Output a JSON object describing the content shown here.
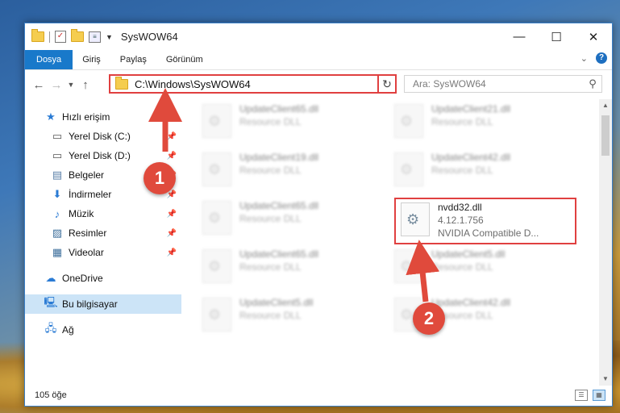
{
  "window": {
    "title": "SysWOW64",
    "controls": {
      "minimize": "—",
      "maximize": "☐",
      "close": "✕"
    }
  },
  "ribbon": {
    "tabs": [
      "Dosya",
      "Giriş",
      "Paylaş",
      "Görünüm"
    ]
  },
  "nav": {
    "address": "C:\\Windows\\SysWOW64",
    "search_placeholder": "Ara: SysWOW64"
  },
  "sidebar": {
    "items": [
      {
        "label": "Hızlı erişim",
        "icon": "star-icon",
        "pinned": false
      },
      {
        "label": "Yerel Disk (C:)",
        "icon": "drive-icon",
        "pinned": true
      },
      {
        "label": "Yerel Disk (D:)",
        "icon": "drive-icon",
        "pinned": true
      },
      {
        "label": "Belgeler",
        "icon": "documents-icon",
        "pinned": true
      },
      {
        "label": "İndirmeler",
        "icon": "download-icon",
        "pinned": true
      },
      {
        "label": "Müzik",
        "icon": "music-icon",
        "pinned": true
      },
      {
        "label": "Resimler",
        "icon": "pictures-icon",
        "pinned": true
      },
      {
        "label": "Videolar",
        "icon": "videos-icon",
        "pinned": true
      },
      {
        "label": "OneDrive",
        "icon": "cloud-icon",
        "pinned": false
      },
      {
        "label": "Bu bilgisayar",
        "icon": "computer-icon",
        "pinned": false
      },
      {
        "label": "Ağ",
        "icon": "network-icon",
        "pinned": false
      }
    ]
  },
  "files": {
    "left_column": [
      {
        "name": "UpdateClient65.dll",
        "type": "Resource DLL"
      },
      {
        "name": "UpdateClient19.dll",
        "type": "Resource DLL"
      },
      {
        "name": "UpdateClient65.dll",
        "type": "Resource DLL"
      },
      {
        "name": "UpdateClient65.dll",
        "type": "Resource DLL"
      },
      {
        "name": "UpdateClient5.dll",
        "type": "Resource DLL"
      }
    ],
    "right_column": [
      {
        "name": "UpdateClient21.dll",
        "type": "Resource DLL"
      },
      {
        "name": "UpdateClient42.dll",
        "type": "Resource DLL"
      },
      {
        "name": "nvdd32.dll",
        "version": "4.12.1.756",
        "type": "NVIDIA Compatible D..."
      },
      {
        "name": "UpdateClient5.dll",
        "type": "Resource DLL"
      },
      {
        "name": "UpdateClient42.dll",
        "type": "Resource DLL"
      }
    ]
  },
  "status": {
    "count": "105 öğe"
  },
  "callouts": {
    "one": "1",
    "two": "2"
  },
  "colors": {
    "accent": "#1979ca",
    "highlight": "#e04040",
    "callout": "#e04a3c"
  }
}
